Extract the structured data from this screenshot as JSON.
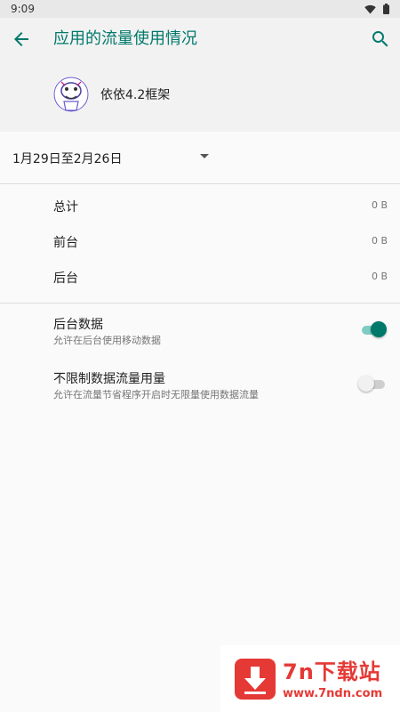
{
  "status_bar": {
    "time": "9:09"
  },
  "app_bar": {
    "title": "应用的流量使用情况"
  },
  "app": {
    "name": "依依4.2框架"
  },
  "cycle": {
    "label": "1月29日至2月26日"
  },
  "usage": [
    {
      "label": "总计",
      "value": "0 B"
    },
    {
      "label": "前台",
      "value": "0 B"
    },
    {
      "label": "后台",
      "value": "0 B"
    }
  ],
  "settings": {
    "background_data": {
      "title": "后台数据",
      "subtitle": "允许在后台使用移动数据",
      "enabled": true
    },
    "unrestricted_data": {
      "title": "不限制数据流量用量",
      "subtitle": "允许在流量节省程序开启时无限量使用数据流量",
      "enabled": false
    }
  },
  "watermark": {
    "title": "7n下载站",
    "url": "www.7ndn.com"
  },
  "colors": {
    "accent": "#00796b",
    "watermark": "#e53935"
  }
}
